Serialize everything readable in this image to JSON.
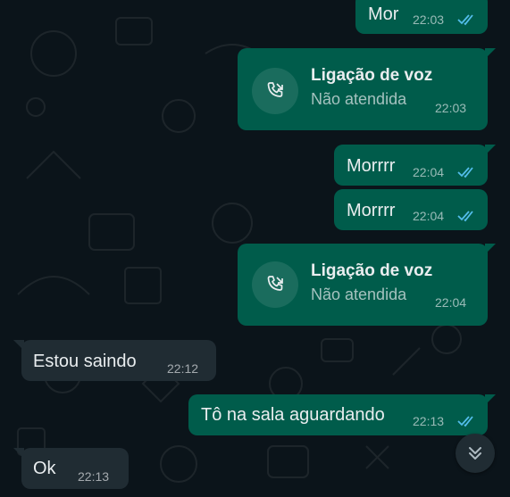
{
  "messages": [
    {
      "text": "Mor",
      "time": "22:03"
    },
    {
      "call_title": "Ligação de voz",
      "call_status": "Não atendida",
      "time": "22:03"
    },
    {
      "text": "Morrrr",
      "time": "22:04"
    },
    {
      "text": "Morrrr",
      "time": "22:04"
    },
    {
      "call_title": "Ligação de voz",
      "call_status": "Não atendida",
      "time": "22:04"
    },
    {
      "text": "Estou saindo",
      "time": "22:12"
    },
    {
      "text": "Tô na sala aguardando",
      "time": "22:13"
    },
    {
      "text": "Ok",
      "time": "22:13"
    }
  ],
  "colors": {
    "background": "#0b141a",
    "outgoing_bubble": "#005c4b",
    "incoming_bubble": "#202c33",
    "read_ticks": "#53bdeb"
  },
  "icons": {
    "call": "missed-voice-call-icon",
    "read_receipt": "double-check-icon",
    "scroll_down": "double-chevron-down-icon"
  }
}
